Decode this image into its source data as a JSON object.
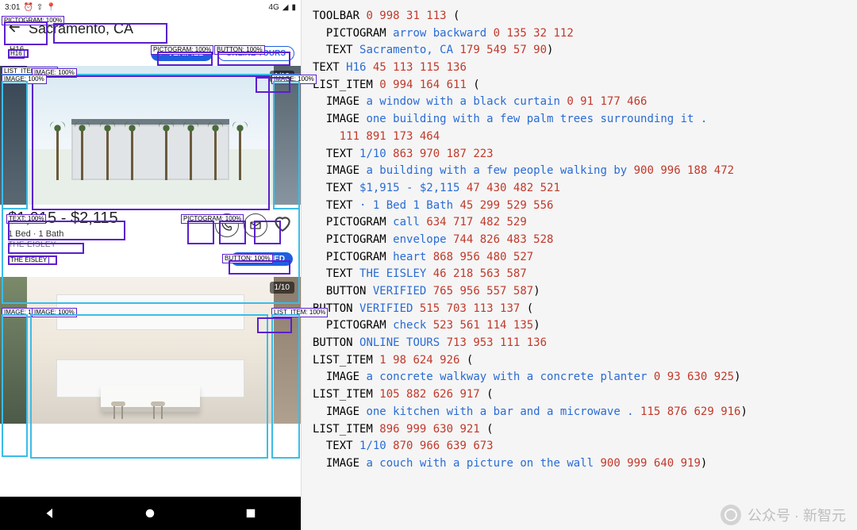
{
  "status": {
    "time": "3:01",
    "signal": "4G"
  },
  "toolbar": {
    "search": "Sacramento, CA"
  },
  "filters": {
    "h16": "H16",
    "verified": "VERIFIED",
    "online_tours": "ONLINE TOURS"
  },
  "listing1": {
    "counter": "1/10",
    "price": "$1,915 - $2,115",
    "beds": "1 Bed · 1 Bath",
    "name": "THE EISLEY",
    "verified": "VERIFIED"
  },
  "listing2": {
    "counter": "1/10"
  },
  "ann_labels": {
    "pict100": "PICTOGRAM: 100%",
    "text100": "TEXT: 100%",
    "image100": "IMAGE: 100%",
    "button100": "BUTTON: 100%",
    "listitem100": "LIST_ITEM: 100%",
    "h16": "H16",
    "the_eisley": "THE EISLEY"
  },
  "ann": [
    {
      "indent": 0,
      "kw": "TOOLBAR",
      "desc": "",
      "nums": "0 998 31 113",
      "tail": " ("
    },
    {
      "indent": 1,
      "kw": "PICTOGRAM",
      "desc": "arrow backward",
      "nums": "0 135 32 112",
      "tail": ""
    },
    {
      "indent": 1,
      "kw": "TEXT",
      "desc": "Sacramento, CA",
      "nums": "179 549 57 90",
      "tail": ")"
    },
    {
      "indent": 0,
      "kw": "TEXT",
      "desc": "H16",
      "nums": "45 113 115 136",
      "tail": ""
    },
    {
      "indent": 0,
      "kw": "LIST_ITEM",
      "desc": "",
      "nums": "0 994 164 611",
      "tail": " ("
    },
    {
      "indent": 1,
      "kw": "IMAGE",
      "desc": "a window with a black curtain",
      "nums": "0 91 177 466",
      "tail": ""
    },
    {
      "indent": 1,
      "kw": "IMAGE",
      "desc": "one building with a few palm trees surrounding it .",
      "nums": "",
      "tail": ""
    },
    {
      "indent": 2,
      "kw": "",
      "desc": "",
      "nums": "111 891 173 464",
      "tail": ""
    },
    {
      "indent": 1,
      "kw": "TEXT",
      "desc": "1/10",
      "nums": "863 970 187 223",
      "tail": ""
    },
    {
      "indent": 1,
      "kw": "IMAGE",
      "desc": "a building with a few people walking by",
      "nums": "900 996 188 472",
      "tail": ""
    },
    {
      "indent": 1,
      "kw": "TEXT",
      "desc": "$1,915 - $2,115",
      "nums": "47 430 482 521",
      "tail": ""
    },
    {
      "indent": 1,
      "kw": "TEXT",
      "desc": "· 1 Bed 1 Bath",
      "nums": "45 299 529 556",
      "tail": ""
    },
    {
      "indent": 1,
      "kw": "PICTOGRAM",
      "desc": "call",
      "nums": "634 717 482 529",
      "tail": ""
    },
    {
      "indent": 1,
      "kw": "PICTOGRAM",
      "desc": "envelope",
      "nums": "744 826 483 528",
      "tail": ""
    },
    {
      "indent": 1,
      "kw": "PICTOGRAM",
      "desc": "heart",
      "nums": "868 956 480 527",
      "tail": ""
    },
    {
      "indent": 1,
      "kw": "TEXT",
      "desc": "THE EISLEY",
      "nums": "46 218 563 587",
      "tail": ""
    },
    {
      "indent": 1,
      "kw": "BUTTON",
      "desc": "VERIFIED",
      "nums": "765 956 557 587",
      "tail": ")"
    },
    {
      "indent": 0,
      "kw": "BUTTON",
      "desc": "VERIFIED",
      "nums": "515 703 113 137",
      "tail": " ("
    },
    {
      "indent": 1,
      "kw": "PICTOGRAM",
      "desc": "check",
      "nums": "523 561 114 135",
      "tail": ")"
    },
    {
      "indent": 0,
      "kw": "BUTTON",
      "desc": "ONLINE TOURS",
      "nums": "713 953 111 136",
      "tail": ""
    },
    {
      "indent": 0,
      "kw": "LIST_ITEM",
      "desc": "",
      "nums": "1 98 624 926",
      "tail": " ("
    },
    {
      "indent": 1,
      "kw": "IMAGE",
      "desc": "a concrete walkway with a concrete planter",
      "nums": "0 93 630 925",
      "tail": ")"
    },
    {
      "indent": 0,
      "kw": "LIST_ITEM",
      "desc": "",
      "nums": "105 882 626 917",
      "tail": " ("
    },
    {
      "indent": 1,
      "kw": "IMAGE",
      "desc": "one kitchen with a bar and a microwave .",
      "nums": "115 876 629 916",
      "tail": ")"
    },
    {
      "indent": 0,
      "kw": "LIST_ITEM",
      "desc": "",
      "nums": "896 999 630 921",
      "tail": " ("
    },
    {
      "indent": 1,
      "kw": "TEXT",
      "desc": "1/10",
      "nums": "870 966 639 673",
      "tail": ""
    },
    {
      "indent": 1,
      "kw": "IMAGE",
      "desc": "a couch with a picture on the wall",
      "nums": "900 999 640 919",
      "tail": ")"
    }
  ],
  "watermark": {
    "text": "公众号 · 新智元"
  }
}
